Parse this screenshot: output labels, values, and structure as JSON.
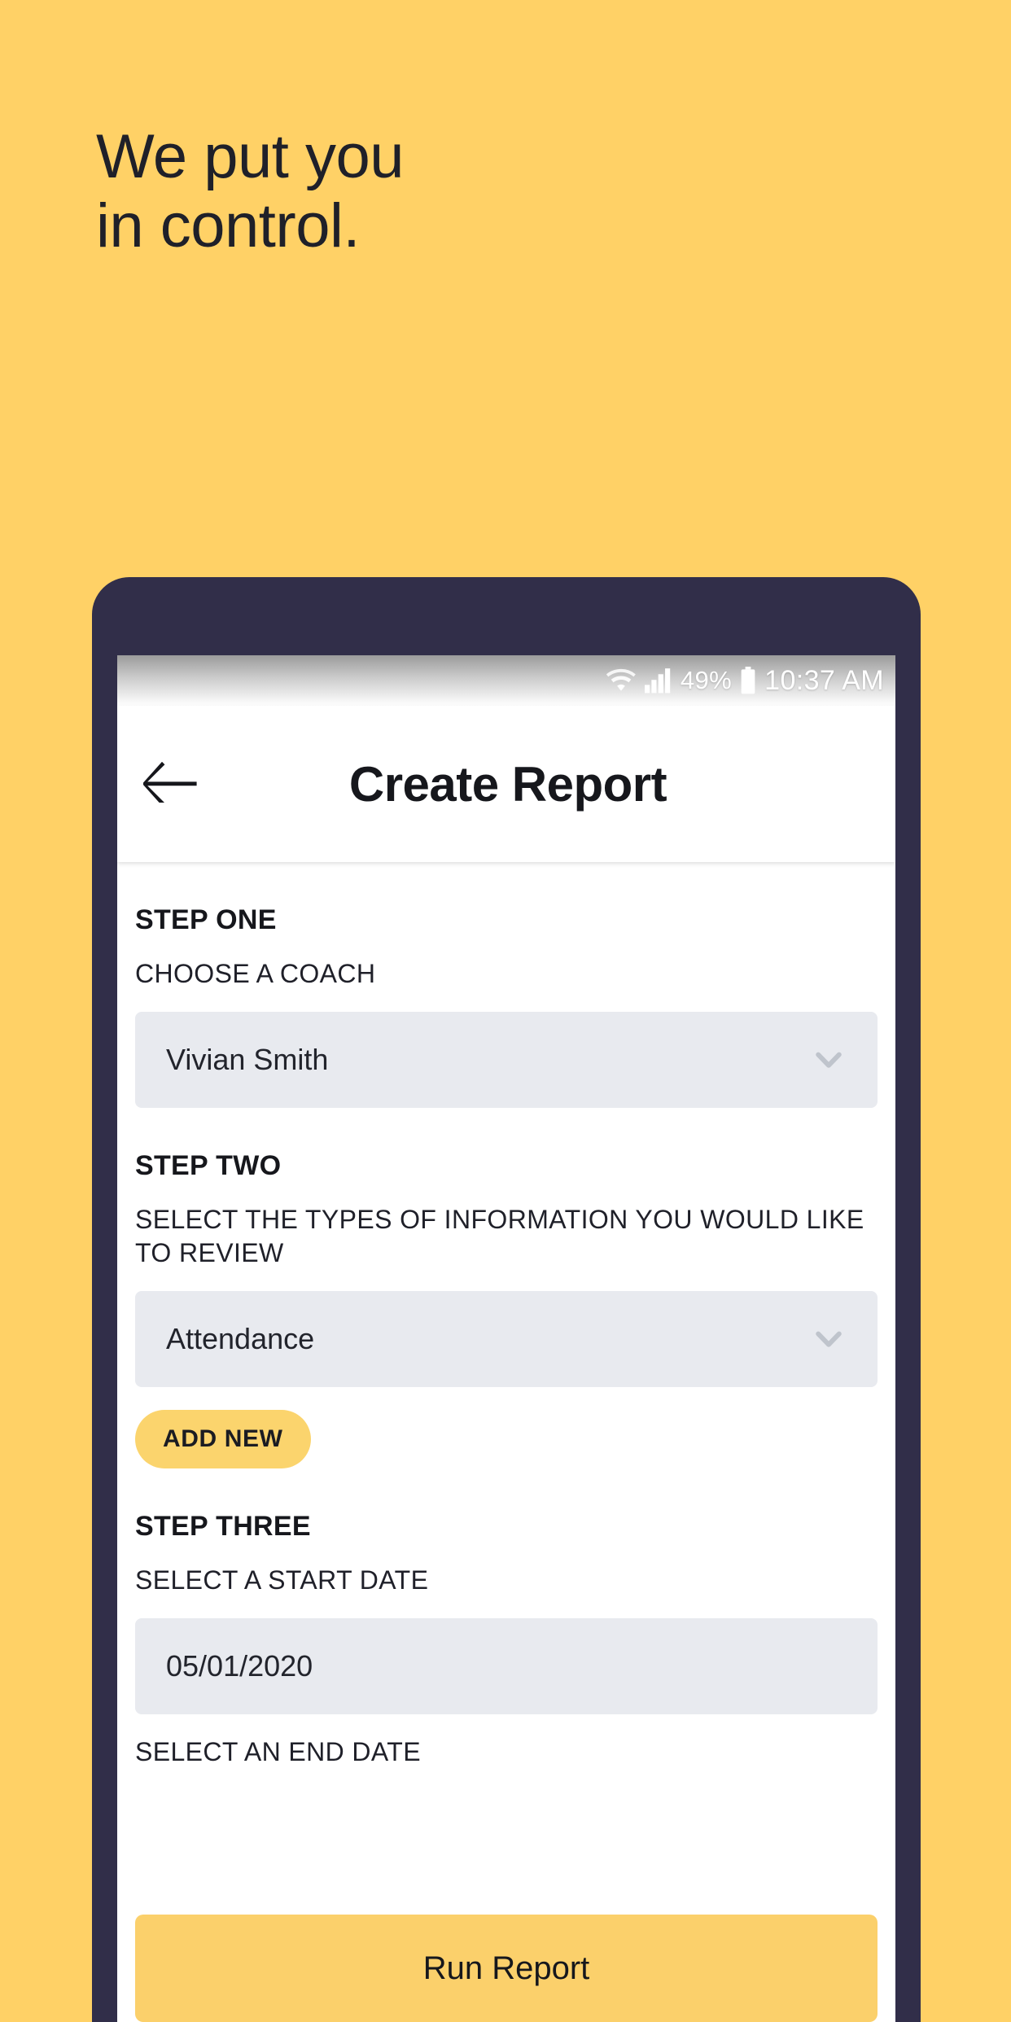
{
  "page": {
    "background_color": "#FFD166",
    "headline": "We put you\nin control."
  },
  "phone": {
    "frame_color": "#312E49",
    "statusbar": {
      "wifi_icon": "wifi-icon",
      "signal_icon": "signal-bars-icon",
      "battery_percent": "49%",
      "battery_icon": "battery-icon",
      "time": "10:37 AM"
    },
    "appbar": {
      "back_icon": "back-arrow-icon",
      "title": "Create Report"
    },
    "screen": {
      "steps": [
        {
          "title": "STEP ONE",
          "subtitle": "CHOOSE A COACH",
          "field": {
            "value": "Vivian Smith",
            "icon": "chevron-down-icon"
          }
        },
        {
          "title": "STEP TWO",
          "subtitle": "SELECT THE TYPES OF INFORMATION YOU WOULD LIKE TO REVIEW",
          "field": {
            "value": "Attendance",
            "icon": "chevron-down-icon"
          },
          "add_button": "ADD NEW"
        },
        {
          "title": "STEP THREE",
          "subtitle": "SELECT A START DATE",
          "field": {
            "value": "05/01/2020"
          },
          "subtitle_end": "SELECT AN END DATE"
        }
      ],
      "cta": {
        "label": "Run Report",
        "color": "#FBD06B"
      }
    }
  },
  "colors": {
    "accent_yellow": "#FFD166",
    "button_yellow": "#FBD06B",
    "dark_navy": "#312E49",
    "field_gray": "#E8EAEF",
    "text_dark": "#16171C",
    "chevron_gray": "#BFC4CC"
  }
}
